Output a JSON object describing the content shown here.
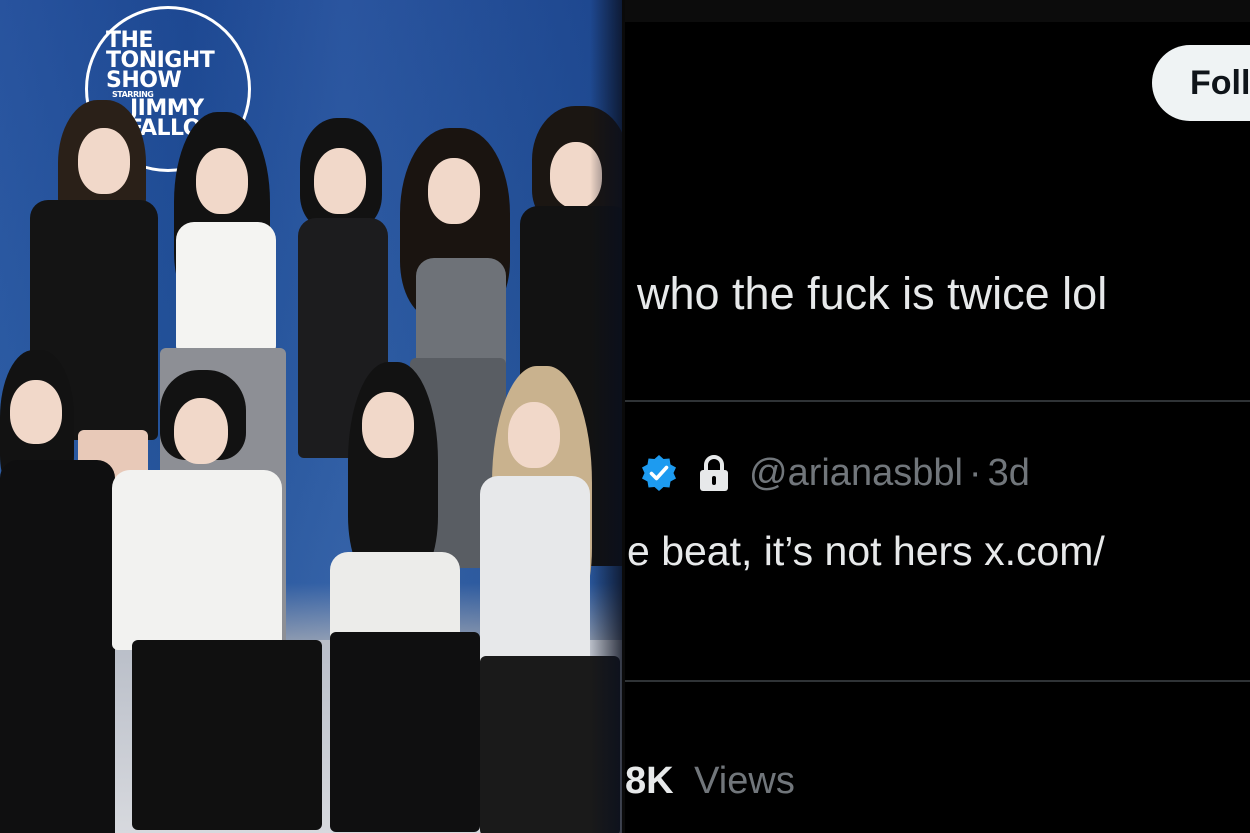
{
  "photo": {
    "logo_lines": [
      "THE",
      "TONIGHT",
      "SHOW",
      "STARRING",
      "JIMMY",
      "FALLON"
    ]
  },
  "tweet": {
    "follow_label": "Foll",
    "text": "who the fuck is twice lol"
  },
  "reply": {
    "handle": "@arianasbbl",
    "separator": "·",
    "time": "3d",
    "text": "e beat, it’s not hers x.com/"
  },
  "views": {
    "count": "8K",
    "label": "Views"
  },
  "colors": {
    "background": "#000000",
    "text_primary": "#e7e9ea",
    "text_secondary": "#71767b",
    "verified": "#1d9bf0",
    "follow_button_bg": "#eff3f4",
    "wall_blue": "#23549f"
  },
  "icons": {
    "verified": "verified-badge-icon",
    "protected": "lock-icon"
  }
}
